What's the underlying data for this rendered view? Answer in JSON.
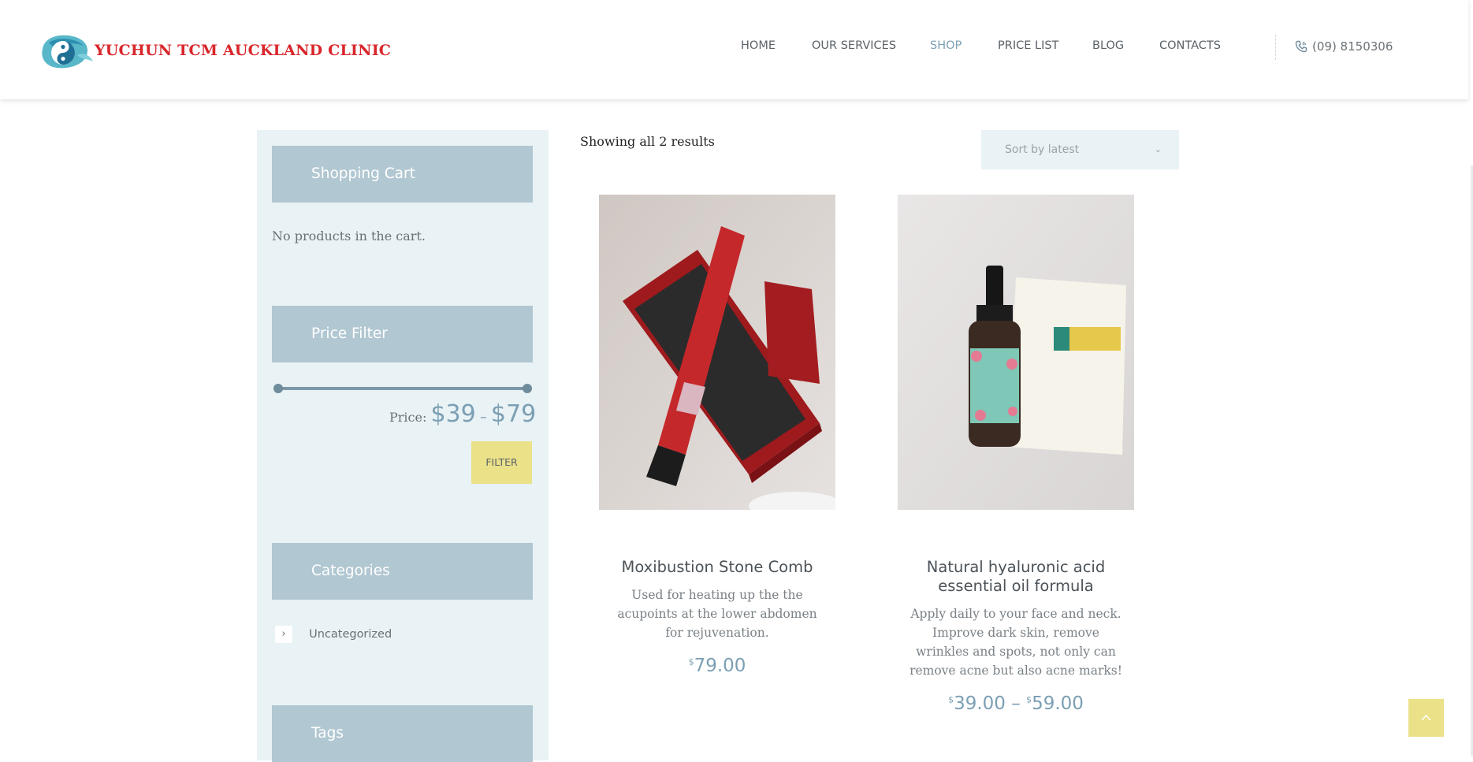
{
  "header": {
    "logo_text": "YUCHUN TCM AUCKLAND CLINIC",
    "nav": [
      {
        "label": "HOME",
        "active": false
      },
      {
        "label": "OUR SERVICES",
        "active": false
      },
      {
        "label": "SHOP",
        "active": true
      },
      {
        "label": "PRICE LIST",
        "active": false
      },
      {
        "label": "BLOG",
        "active": false
      },
      {
        "label": "CONTACTS",
        "active": false
      }
    ],
    "phone": "(09) 8150306",
    "phone_icon": "phone-icon"
  },
  "sidebar": {
    "cart_title": "Shopping Cart",
    "cart_empty_text": "No products in the cart.",
    "price_filter_title": "Price Filter",
    "price_label": "Price:",
    "price_min": "$39",
    "price_dash": "–",
    "price_max": "$79",
    "price_range_selected": [
      39,
      79
    ],
    "filter_button": "FILTER",
    "categories_title": "Categories",
    "categories": [
      {
        "label": "Uncategorized"
      }
    ],
    "tags_title": "Tags"
  },
  "main": {
    "results_text": "Showing all 2 results",
    "sort_value": "Sort by latest",
    "products": [
      {
        "title": "Moxibustion Stone Comb",
        "description": "Used for heating up the the acupoints at the lower abdomen for rejuvenation.",
        "price_symbol": "$",
        "price": "79.00"
      },
      {
        "title": "Natural hyaluronic acid essential oil formula",
        "description": "Apply daily to your face and neck. Improve dark skin, remove wrinkles and spots, not only can remove acne but also acne marks!",
        "price_symbol_1": "$",
        "price_1": "39.00",
        "price_dash": "–",
        "price_symbol_2": "$",
        "price_2": "59.00"
      }
    ]
  },
  "colors": {
    "accent_blue": "#7b9fb4",
    "widget_title_bg": "#b1c7d1",
    "sidebar_bg": "#e9f2f5",
    "button_yellow": "#ebe189",
    "logo_red": "#d9262b"
  }
}
